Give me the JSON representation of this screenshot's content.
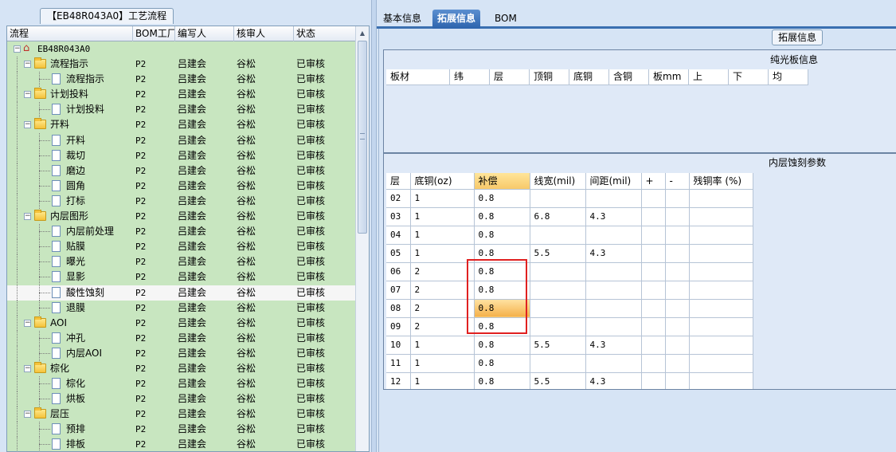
{
  "left_panel": {
    "title": "【EB48R043A0】工艺流程",
    "columns": [
      "流程",
      "BOM工厂",
      "编写人",
      "核审人",
      "状态"
    ],
    "rows": [
      {
        "label": "EB48R043A0",
        "level": 0,
        "kind": "root",
        "bom": "",
        "author": "",
        "reviewer": "",
        "status": ""
      },
      {
        "label": "流程指示",
        "level": 1,
        "kind": "folder",
        "bom": "P2",
        "author": "吕建会",
        "reviewer": "谷松",
        "status": "已审核"
      },
      {
        "label": "流程指示",
        "level": 2,
        "kind": "doc",
        "bom": "P2",
        "author": "吕建会",
        "reviewer": "谷松",
        "status": "已审核"
      },
      {
        "label": "计划投料",
        "level": 1,
        "kind": "folder",
        "bom": "P2",
        "author": "吕建会",
        "reviewer": "谷松",
        "status": "已审核"
      },
      {
        "label": "计划投料",
        "level": 2,
        "kind": "doc",
        "bom": "P2",
        "author": "吕建会",
        "reviewer": "谷松",
        "status": "已审核"
      },
      {
        "label": "开料",
        "level": 1,
        "kind": "folder",
        "bom": "P2",
        "author": "吕建会",
        "reviewer": "谷松",
        "status": "已审核"
      },
      {
        "label": "开料",
        "level": 2,
        "kind": "doc",
        "bom": "P2",
        "author": "吕建会",
        "reviewer": "谷松",
        "status": "已审核"
      },
      {
        "label": "裁切",
        "level": 2,
        "kind": "doc",
        "bom": "P2",
        "author": "吕建会",
        "reviewer": "谷松",
        "status": "已审核"
      },
      {
        "label": "磨边",
        "level": 2,
        "kind": "doc",
        "bom": "P2",
        "author": "吕建会",
        "reviewer": "谷松",
        "status": "已审核"
      },
      {
        "label": "圆角",
        "level": 2,
        "kind": "doc",
        "bom": "P2",
        "author": "吕建会",
        "reviewer": "谷松",
        "status": "已审核"
      },
      {
        "label": "打标",
        "level": 2,
        "kind": "doc",
        "bom": "P2",
        "author": "吕建会",
        "reviewer": "谷松",
        "status": "已审核"
      },
      {
        "label": "内层图形",
        "level": 1,
        "kind": "folder",
        "bom": "P2",
        "author": "吕建会",
        "reviewer": "谷松",
        "status": "已审核"
      },
      {
        "label": "内层前处理",
        "level": 2,
        "kind": "doc",
        "bom": "P2",
        "author": "吕建会",
        "reviewer": "谷松",
        "status": "已审核"
      },
      {
        "label": "贴膜",
        "level": 2,
        "kind": "doc",
        "bom": "P2",
        "author": "吕建会",
        "reviewer": "谷松",
        "status": "已审核"
      },
      {
        "label": "曝光",
        "level": 2,
        "kind": "doc",
        "bom": "P2",
        "author": "吕建会",
        "reviewer": "谷松",
        "status": "已审核"
      },
      {
        "label": "显影",
        "level": 2,
        "kind": "doc",
        "bom": "P2",
        "author": "吕建会",
        "reviewer": "谷松",
        "status": "已审核"
      },
      {
        "label": "酸性蚀刻",
        "level": 2,
        "kind": "doc",
        "bom": "P2",
        "author": "吕建会",
        "reviewer": "谷松",
        "status": "已审核",
        "selected": true
      },
      {
        "label": "退膜",
        "level": 2,
        "kind": "doc",
        "bom": "P2",
        "author": "吕建会",
        "reviewer": "谷松",
        "status": "已审核"
      },
      {
        "label": "AOI",
        "level": 1,
        "kind": "folder",
        "bom": "P2",
        "author": "吕建会",
        "reviewer": "谷松",
        "status": "已审核"
      },
      {
        "label": "冲孔",
        "level": 2,
        "kind": "doc",
        "bom": "P2",
        "author": "吕建会",
        "reviewer": "谷松",
        "status": "已审核"
      },
      {
        "label": "内层AOI",
        "level": 2,
        "kind": "doc",
        "bom": "P2",
        "author": "吕建会",
        "reviewer": "谷松",
        "status": "已审核"
      },
      {
        "label": "棕化",
        "level": 1,
        "kind": "folder",
        "bom": "P2",
        "author": "吕建会",
        "reviewer": "谷松",
        "status": "已审核"
      },
      {
        "label": "棕化",
        "level": 2,
        "kind": "doc",
        "bom": "P2",
        "author": "吕建会",
        "reviewer": "谷松",
        "status": "已审核"
      },
      {
        "label": "烘板",
        "level": 2,
        "kind": "doc",
        "bom": "P2",
        "author": "吕建会",
        "reviewer": "谷松",
        "status": "已审核"
      },
      {
        "label": "层压",
        "level": 1,
        "kind": "folder",
        "bom": "P2",
        "author": "吕建会",
        "reviewer": "谷松",
        "status": "已审核"
      },
      {
        "label": "预排",
        "level": 2,
        "kind": "doc",
        "bom": "P2",
        "author": "吕建会",
        "reviewer": "谷松",
        "status": "已审核"
      },
      {
        "label": "排板",
        "level": 2,
        "kind": "doc",
        "bom": "P2",
        "author": "吕建会",
        "reviewer": "谷松",
        "status": "已审核"
      }
    ]
  },
  "tabs": [
    {
      "label": "基本信息",
      "active": false
    },
    {
      "label": "拓展信息",
      "active": true
    },
    {
      "label": "BOM",
      "active": false
    }
  ],
  "ext_label": "拓展信息",
  "pure_board": {
    "title": "纯光板信息",
    "columns": [
      "板材",
      "纬",
      "层",
      "顶铜",
      "底铜",
      "含铜",
      "板mm",
      "上",
      "下",
      "均"
    ]
  },
  "inner_etch": {
    "title": "内层蚀刻参数",
    "columns": [
      "层",
      "底铜(oz)",
      "补偿",
      "线宽(mil)",
      "间距(mil)",
      "+",
      "-",
      "残铜率 (%)"
    ],
    "rows": [
      [
        "02",
        "1",
        "0.8",
        "",
        "",
        "",
        "",
        ""
      ],
      [
        "03",
        "1",
        "0.8",
        "6.8",
        "4.3",
        "",
        "",
        ""
      ],
      [
        "04",
        "1",
        "0.8",
        "",
        "",
        "",
        "",
        ""
      ],
      [
        "05",
        "1",
        "0.8",
        "5.5",
        "4.3",
        "",
        "",
        ""
      ],
      [
        "06",
        "2",
        "0.8",
        "",
        "",
        "",
        "",
        ""
      ],
      [
        "07",
        "2",
        "0.8",
        "",
        "",
        "",
        "",
        ""
      ],
      [
        "08",
        "2",
        "0.8",
        "",
        "",
        "",
        "",
        ""
      ],
      [
        "09",
        "2",
        "0.8",
        "",
        "",
        "",
        "",
        ""
      ],
      [
        "10",
        "1",
        "0.8",
        "5.5",
        "4.3",
        "",
        "",
        ""
      ],
      [
        "11",
        "1",
        "0.8",
        "",
        "",
        "",
        "",
        ""
      ],
      [
        "12",
        "1",
        "0.8",
        "5.5",
        "4.3",
        "",
        "",
        ""
      ]
    ],
    "selected_row": 6,
    "selected_col": 2
  },
  "colors": {
    "tree_bg": "#c8e6c0",
    "tab_active": "#2c63ad",
    "highlight_box": "#e02020",
    "selected_cell": "#f4b04a"
  }
}
